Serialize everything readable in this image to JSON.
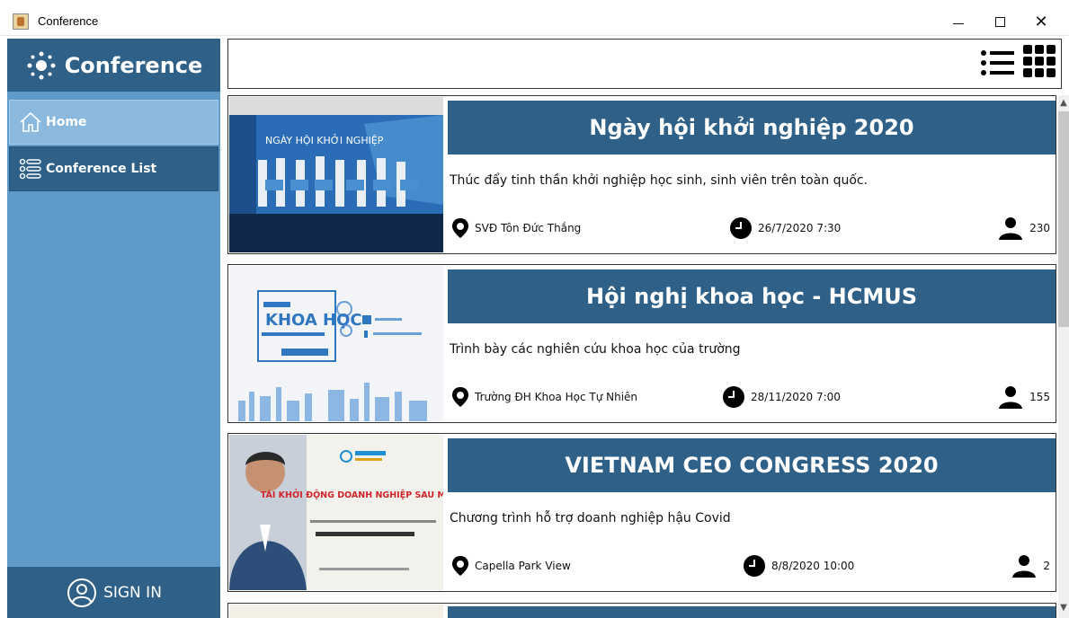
{
  "window": {
    "title": "Conference",
    "controls": {
      "minimize": "minimize",
      "maximize": "maximize",
      "close": "✕"
    }
  },
  "sidebar": {
    "header": "Conference",
    "items": [
      {
        "label": "Home",
        "icon": "home-icon"
      },
      {
        "label": "Conference List",
        "icon": "list-icon"
      }
    ],
    "footer": {
      "label": "SIGN IN",
      "icon": "user-circle-icon"
    }
  },
  "toolbar": {
    "list_view_icon": "list-view-icon",
    "grid_view_icon": "grid-view-icon"
  },
  "conferences": [
    {
      "title": "Ngày hội khởi nghiệp 2020",
      "description": "Thúc đẩy tinh thần khởi nghiệp học sinh, sinh viên trên toàn quốc.",
      "location": "SVĐ Tôn Đức Thắng",
      "datetime": "26/7/2020 7:30",
      "attendees": "230",
      "image_text": "NGÀY HỘI KHỞI NGHIỆP"
    },
    {
      "title": "Hội nghị khoa học - HCMUS",
      "description": "Trình bày các nghiên cứu khoa học của trường",
      "location": "Trường ĐH Khoa Học Tự Nhiên",
      "datetime": "28/11/2020 7:00",
      "attendees": "155",
      "image_text": "KHOA HỌC"
    },
    {
      "title": "VIETNAM CEO CONGRESS 2020",
      "description": "Chương trình hỗ trợ doanh nghiệp hậu Covid",
      "location": "Capella Park View",
      "datetime": "8/8/2020 10:00",
      "attendees": "2",
      "image_text": "TÁI KHỞI ĐỘNG DOANH NGHIỆP SAU MÙA DỊCH"
    }
  ],
  "colors": {
    "accent": "#2f6088",
    "sidebar": "#5f9ac9",
    "home_active": "#8bb9dd"
  }
}
